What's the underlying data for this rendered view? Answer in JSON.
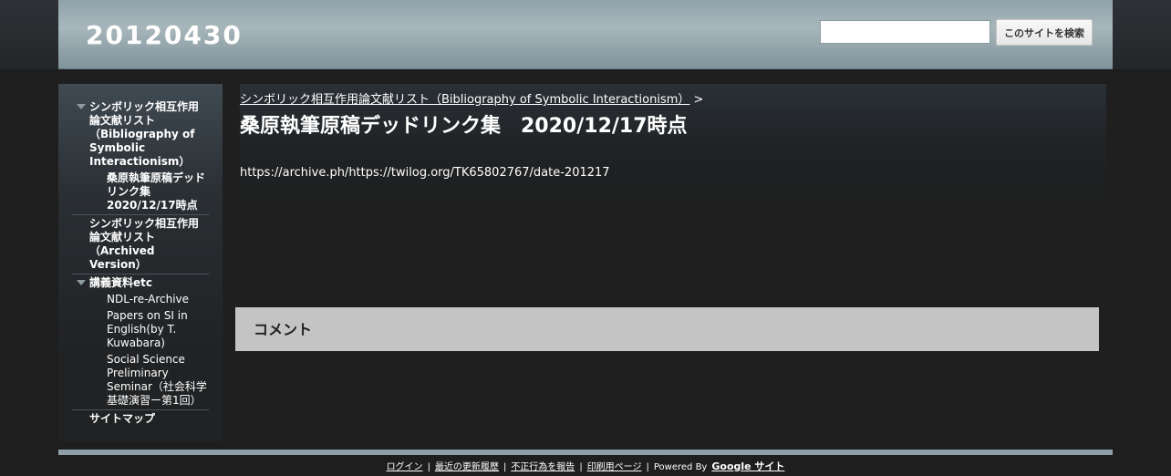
{
  "header": {
    "site_title": "20120430",
    "search_placeholder": "",
    "search_button": "このサイトを検索"
  },
  "sidebar": {
    "items": [
      {
        "label": "シンボリック相互作用論文献リスト（Bibliography of Symbolic Interactionism）",
        "level": 1,
        "expanded": true
      },
      {
        "label": "桑原執筆原稿デッドリンク集 2020/12/17時点",
        "level": 2,
        "current": true
      },
      {
        "label": "シンボリック相互作用論文献リスト（Archived Version）",
        "level": 1
      },
      {
        "label": "講義資料etc",
        "level": 1,
        "expanded": true
      },
      {
        "label": "NDL-re-Archive",
        "level": 2
      },
      {
        "label": "Papers on SI in English(by T. Kuwabara)",
        "level": 2
      },
      {
        "label": "Social Science Preliminary Seminar（社会科学基礎演習ー第1回）",
        "level": 2
      },
      {
        "label": "サイトマップ",
        "level": 1
      }
    ]
  },
  "main": {
    "breadcrumb_link": "シンボリック相互作用論文献リスト（Bibliography of Symbolic Interactionism）",
    "breadcrumb_sep": ">",
    "page_title": "桑原執筆原稿デッドリンク集　2020/12/17時点",
    "content": "https://archive.ph/https://twilog.org/TK65802767/date-201217"
  },
  "comments": {
    "title": "コメント"
  },
  "footer": {
    "links": [
      "ログイン",
      "最近の更新履歴",
      "不正行為を報告",
      "印刷用ページ"
    ],
    "powered_by": "Powered By",
    "google_sites": "Google サイト"
  },
  "colors": {
    "background": "#1e1e1e",
    "header": "#a7b6bb",
    "comment_box": "#c4c4c4",
    "footer_bar": "#8fa0a8"
  }
}
